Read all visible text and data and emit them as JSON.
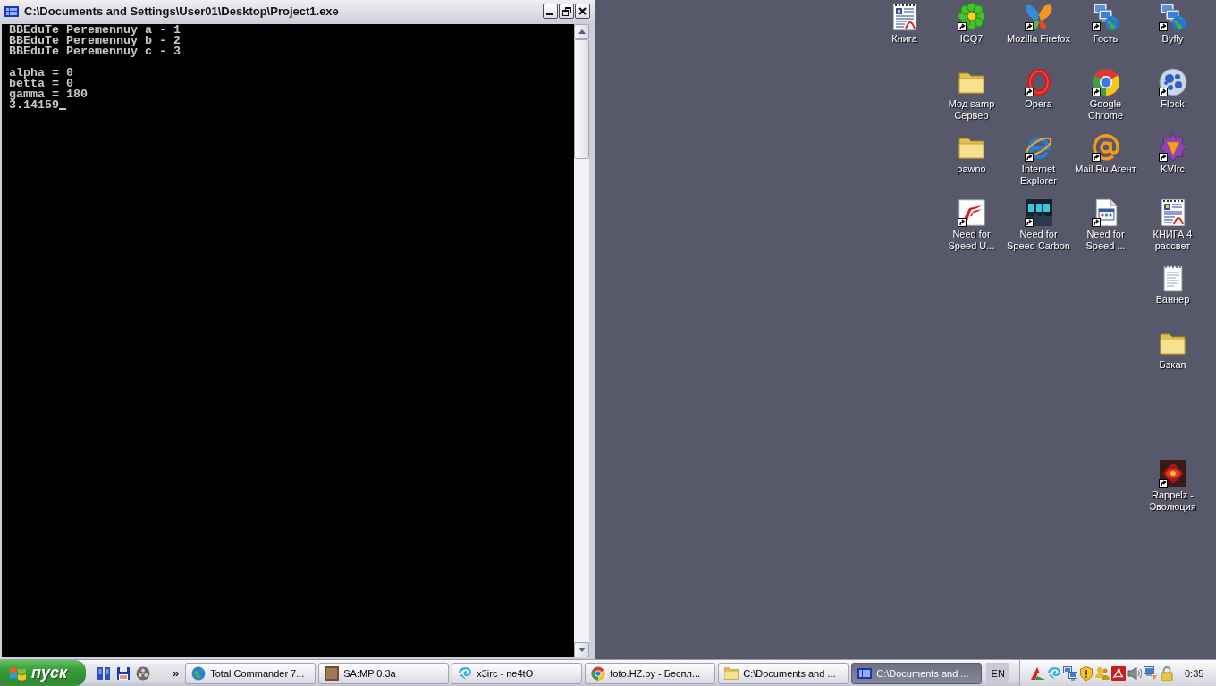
{
  "console_window": {
    "title": "C:\\Documents and Settings\\User01\\Desktop\\Project1.exe",
    "output": [
      {
        "lines": [
          "BBEduTe Peremennuy a - 1",
          "BBEduTe Peremennuy b - 2",
          "BBEduTe Peremennuy c - 3"
        ]
      },
      {
        "lines": [
          "alpha = 0",
          "betta = 0",
          "gamma = 180",
          "3.14159"
        ]
      }
    ],
    "cursor_visible": true
  },
  "desktop": {
    "icons": [
      {
        "label": "Книга",
        "kind": "document",
        "shortcut": false
      },
      {
        "label": "ICQ7",
        "kind": "flower",
        "shortcut": true
      },
      {
        "label": "Mozilla Firefox",
        "kind": "butterfly",
        "shortcut": true
      },
      {
        "label": "Гость",
        "kind": "network",
        "shortcut": true
      },
      {
        "label": "Byfly",
        "kind": "network",
        "shortcut": true
      },
      {
        "label": "Мод samp Сервер",
        "kind": "folder",
        "shortcut": false
      },
      {
        "label": "Opera",
        "kind": "ring",
        "shortcut": true
      },
      {
        "label": "Google Chrome",
        "kind": "segmented",
        "shortcut": true
      },
      {
        "label": "Flock",
        "kind": "ball",
        "shortcut": true
      },
      {
        "label": "pawno",
        "kind": "folder",
        "shortcut": false
      },
      {
        "label": "Internet Explorer",
        "kind": "orbit",
        "shortcut": true
      },
      {
        "label": "Mail.Ru Агент",
        "kind": "at",
        "shortcut": true
      },
      {
        "label": "KVIrc",
        "kind": "star",
        "shortcut": true
      },
      {
        "label": "Need for Speed U...",
        "kind": "slash",
        "shortcut": true
      },
      {
        "label": "Need for Speed Carbon",
        "kind": "tile",
        "shortcut": true
      },
      {
        "label": "Need for Speed ...",
        "kind": "page",
        "shortcut": true
      },
      {
        "label": "КНИГА 4 рассвет",
        "kind": "document",
        "shortcut": false
      },
      {
        "label": "Баннер",
        "kind": "notepad",
        "shortcut": false
      },
      {
        "label": "Бэкап",
        "kind": "folder",
        "shortcut": false
      },
      {
        "label": "Rappelz - Эволюция",
        "kind": "emblem",
        "shortcut": true
      }
    ]
  },
  "taskbar": {
    "start_button": {
      "label": "пуск"
    },
    "quick_launch_more": "»",
    "tasks": [
      {
        "label": "Total Commander 7...",
        "kind": "globe",
        "selected": false
      },
      {
        "label": "SA:MP 0.3a",
        "kind": "image",
        "selected": false
      },
      {
        "label": "x3irc - ne4tO",
        "kind": "swirl",
        "selected": false
      },
      {
        "label": "foto.HZ.by - Беспл...",
        "kind": "segmented",
        "selected": false
      },
      {
        "label": "C:\\Documents and ...",
        "kind": "folder",
        "selected": false
      },
      {
        "label": "C:\\Documents and ...",
        "kind": "console",
        "selected": true
      }
    ],
    "language": "EN",
    "clock": "0:35"
  }
}
